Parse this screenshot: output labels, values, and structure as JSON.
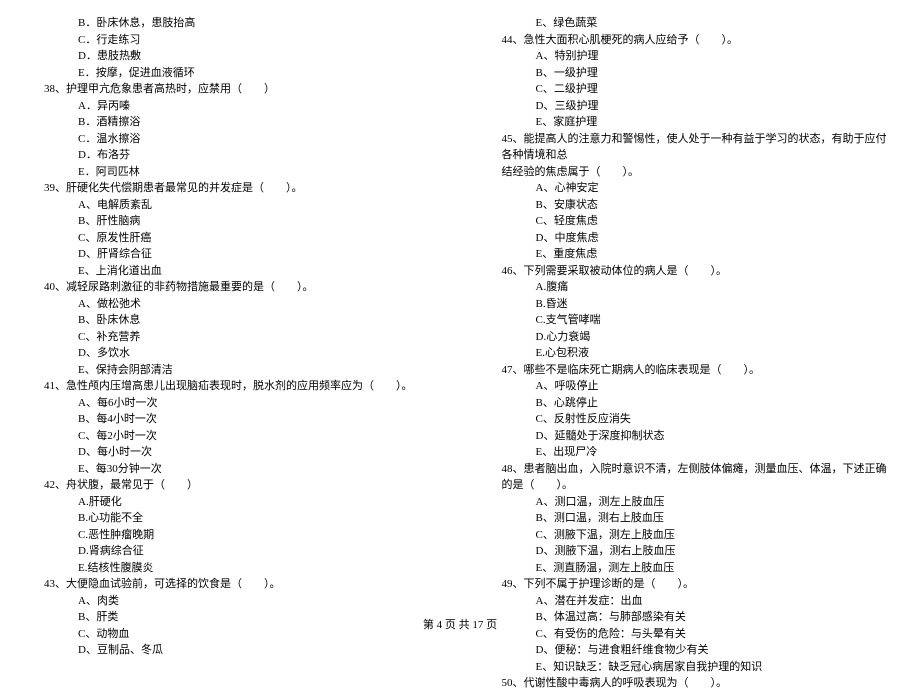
{
  "left": {
    "opts_a": [
      "B．卧床休息，患肢抬高",
      "C．行走练习",
      "D．患肢热敷",
      "E．按摩，促进血液循环"
    ],
    "q38": "38、护理甲亢危象患者高热时，应禁用（　　）",
    "q38_opts": [
      "A．异丙嗪",
      "B．酒精擦浴",
      "C．温水擦浴",
      "D．布洛芬",
      "E．阿司匹林"
    ],
    "q39": "39、肝硬化失代偿期患者最常见的并发症是（　　）。",
    "q39_opts": [
      "A、电解质紊乱",
      "B、肝性脑病",
      "C、原发性肝癌",
      "D、肝肾综合征",
      "E、上消化道出血"
    ],
    "q40": "40、减轻尿路刺激征的非药物措施最重要的是（　　）。",
    "q40_opts": [
      "A、做松弛术",
      "B、卧床休息",
      "C、补充营养",
      "D、多饮水",
      "E、保持会阴部清洁"
    ],
    "q41": "41、急性颅内压增高患儿出现脑疝表现时，脱水剂的应用频率应为（　　）。",
    "q41_opts": [
      "A、每6小时一次",
      "B、每4小时一次",
      "C、每2小时一次",
      "D、每小时一次",
      "E、每30分钟一次"
    ],
    "q42": "42、舟状腹，最常见于（　　）",
    "q42_opts": [
      "A.肝硬化",
      "B.心功能不全",
      "C.恶性肿瘤晚期",
      "D.肾病综合征",
      "E.结核性腹膜炎"
    ],
    "q43": "43、大便隐血试验前，可选择的饮食是（　　）。",
    "q43_opts": [
      "A、肉类",
      "B、肝类",
      "C、动物血",
      "D、豆制品、冬瓜"
    ]
  },
  "right": {
    "opt_e43": "E、绿色蔬菜",
    "q44": "44、急性大面积心肌梗死的病人应给予（　　）。",
    "q44_opts": [
      "A、特别护理",
      "B、一级护理",
      "C、二级护理",
      "D、三级护理",
      "E、家庭护理"
    ],
    "q45_a": "45、能提高人的注意力和警惕性，使人处于一种有益于学习的状态，有助于应付各种情境和总",
    "q45_b": "结经验的焦虑属于（　　）。",
    "q45_opts": [
      "A、心神安定",
      "B、安康状态",
      "C、轻度焦虑",
      "D、中度焦虑",
      "E、重度焦虑"
    ],
    "q46": "46、下列需要采取被动体位的病人是（　　）。",
    "q46_opts": [
      "A.腹痛",
      "B.昏迷",
      "C.支气管哮喘",
      "D.心力衰竭",
      "E.心包积液"
    ],
    "q47": "47、哪些不是临床死亡期病人的临床表现是（　　）。",
    "q47_opts": [
      "A、呼吸停止",
      "B、心跳停止",
      "C、反射性反应消失",
      "D、延髓处于深度抑制状态",
      "E、出现尸冷"
    ],
    "q48": "48、患者脑出血，入院时意识不清，左侧肢体偏瘫，测量血压、体温，下述正确的是（　　）。",
    "q48_opts": [
      "A、测口温，测左上肢血压",
      "B、测口温，测右上肢血压",
      "C、测腋下温，测左上肢血压",
      "D、测腋下温，测右上肢血压",
      "E、测直肠温，测左上肢血压"
    ],
    "q49": "49、下列不属于护理诊断的是（　　）。",
    "q49_opts": [
      "A、潜在并发症：出血",
      "B、体温过高：与肺部感染有关",
      "C、有受伤的危险：与头晕有关",
      "D、便秘：与进食粗纤维食物少有关",
      "E、知识缺乏：缺乏冠心病居家自我护理的知识"
    ],
    "q50": "50、代谢性酸中毒病人的呼吸表现为（　　）。"
  },
  "footer": "第 4 页 共 17 页"
}
